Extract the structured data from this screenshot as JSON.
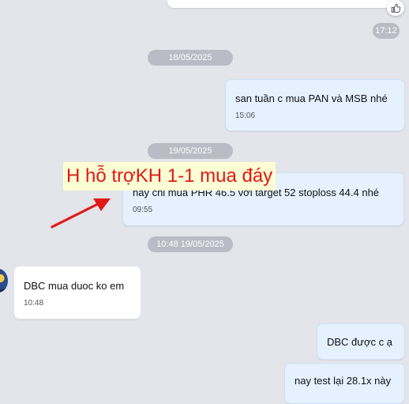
{
  "top_message": {
    "time": "17:12"
  },
  "date_separators": [
    "18/05/2025",
    "19/05/2025",
    "10:48 19/05/2025"
  ],
  "messages": [
    {
      "text": "san tuần c mua PAN và MSB nhé",
      "time": "15:06"
    },
    {
      "text": "nay chỉ mua PHR 46.5 với target 52 stoploss 44.4 nhé",
      "time": "09:55"
    },
    {
      "text": "DBC mua duoc ko em",
      "time": "10:48"
    },
    {
      "text": "DBC được c ạ"
    },
    {
      "text": "nay test lại 28.1x này"
    }
  ],
  "annotation": {
    "text": "H hỗ trợKH 1-1 mua đáy",
    "color": "#e01818"
  },
  "colors": {
    "background": "#e3e5ea",
    "sent_bubble": "#e5f1ff",
    "received_bubble": "#ffffff",
    "date_pill": "#b9bcc4"
  }
}
